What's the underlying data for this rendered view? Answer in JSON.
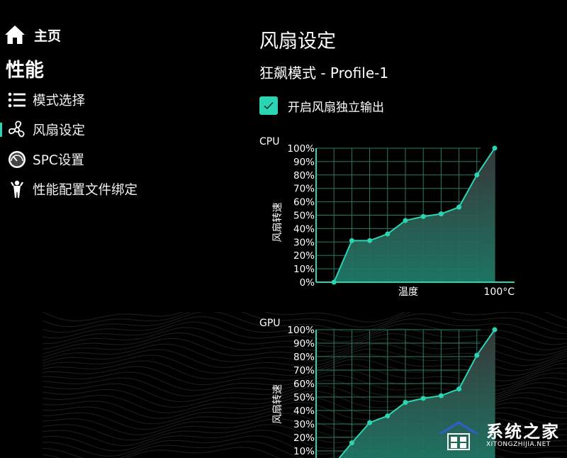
{
  "sidebar": {
    "home_label": "主页",
    "section_title": "性能",
    "items": [
      {
        "label": "模式选择",
        "icon": "list-icon",
        "active": false
      },
      {
        "label": "风扇设定",
        "icon": "fan-icon",
        "active": true
      },
      {
        "label": "SPC设置",
        "icon": "gauge-icon",
        "active": false
      },
      {
        "label": "性能配置文件绑定",
        "icon": "person-icon",
        "active": false
      }
    ]
  },
  "main": {
    "title": "风扇设定",
    "profile": "狂飙模式 - Profile-1",
    "checkbox_label": "开启风扇独立输出",
    "checkbox_checked": true
  },
  "colors": {
    "accent": "#2bd4b2",
    "background": "#000000"
  },
  "chart_data": [
    {
      "type": "area",
      "title": "CPU",
      "ylabel": "风扇转速",
      "xlabel": "温度",
      "x_end_label": "100°C",
      "yticks": [
        "100%",
        "90%",
        "80%",
        "70%",
        "60%",
        "50%",
        "40%",
        "30%",
        "20%",
        "10%",
        "0%"
      ],
      "ylim": [
        0,
        100
      ],
      "xlim": [
        0,
        100
      ],
      "x": [
        10,
        20,
        30,
        40,
        50,
        60,
        70,
        80,
        90,
        100
      ],
      "y": [
        0,
        31,
        31,
        36,
        46,
        49,
        51,
        56,
        80,
        100
      ]
    },
    {
      "type": "area",
      "title": "GPU",
      "ylabel": "风扇转速",
      "xlabel": "",
      "yticks": [
        "100%",
        "90%",
        "80%",
        "70%",
        "60%",
        "50%",
        "40%",
        "30%",
        "20%",
        "10%"
      ],
      "ylim": [
        0,
        100
      ],
      "xlim": [
        0,
        100
      ],
      "x": [
        10,
        20,
        30,
        40,
        50,
        60,
        70,
        80,
        90,
        100
      ],
      "y": [
        0,
        16,
        31,
        36,
        46,
        49,
        51,
        56,
        81,
        100
      ]
    }
  ],
  "watermark": {
    "main": "系统之家",
    "sub": "XITONGZHIJIA.NET"
  }
}
